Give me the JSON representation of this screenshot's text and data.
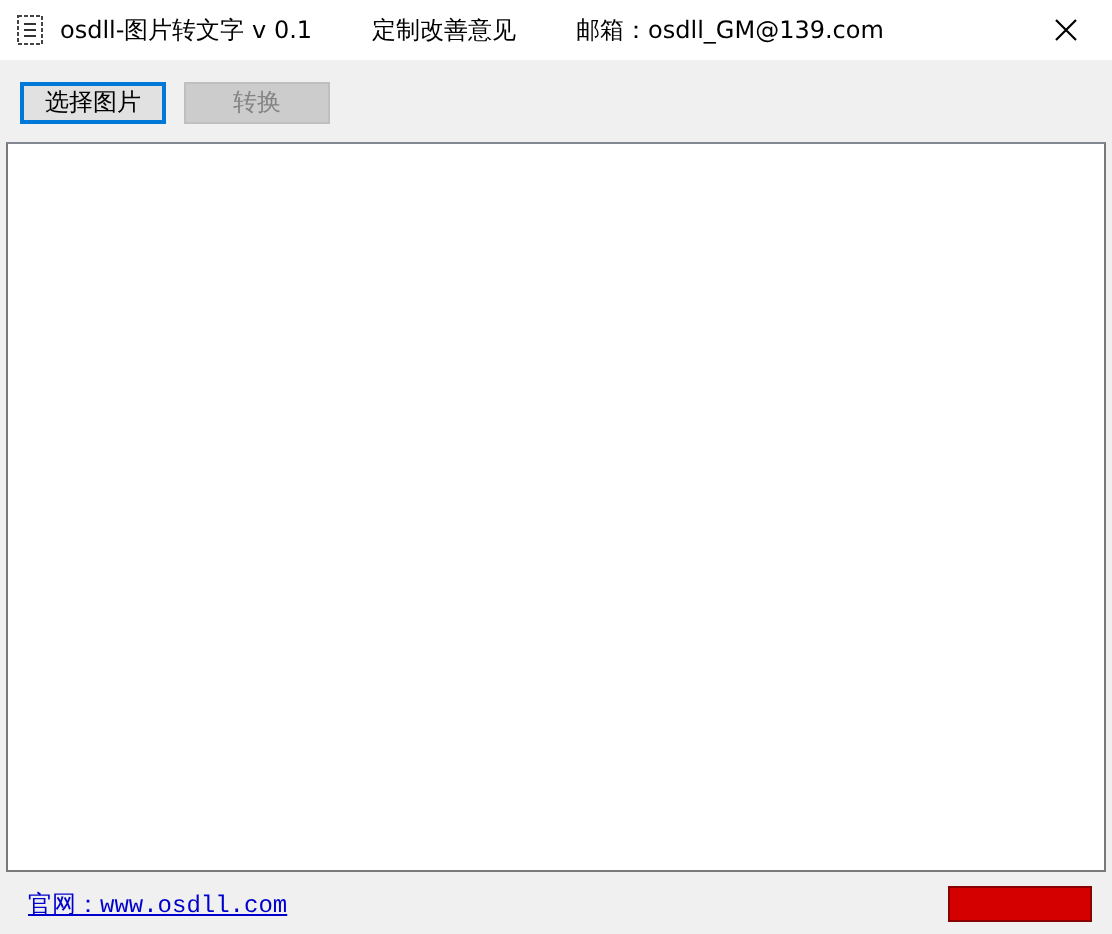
{
  "window": {
    "title": "osdll-图片转文字 v 0.1",
    "menu": [
      {
        "label": "定制改善意见"
      },
      {
        "label": "邮箱：osdll_GM@139.com"
      }
    ]
  },
  "toolbar": {
    "buttons": [
      {
        "label": "选择图片",
        "disabled": false,
        "focused": true
      },
      {
        "label": "转换",
        "disabled": true,
        "focused": false
      }
    ]
  },
  "footer": {
    "link": "官网：www.osdll.com"
  }
}
